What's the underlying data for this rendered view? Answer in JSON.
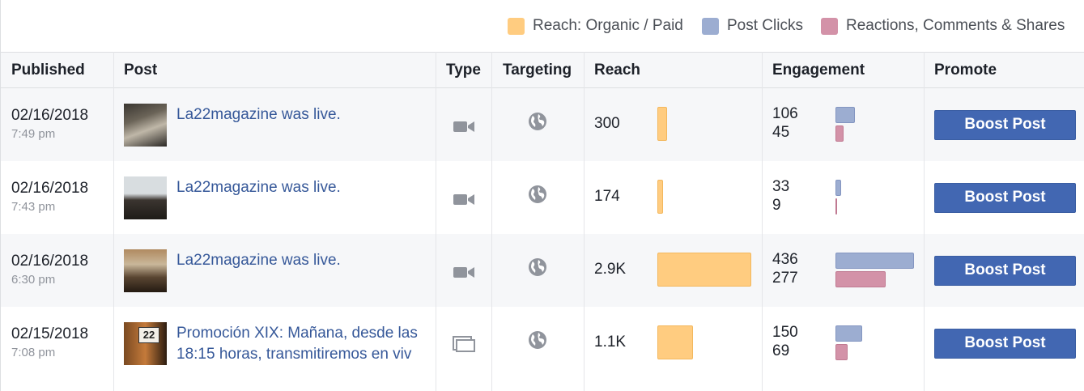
{
  "legend": [
    {
      "label": "Reach: Organic / Paid",
      "color": "#ffcc80"
    },
    {
      "label": "Post Clicks",
      "color": "#9cadd1"
    },
    {
      "label": "Reactions, Comments & Shares",
      "color": "#d392a8"
    }
  ],
  "headers": {
    "published": "Published",
    "post": "Post",
    "type": "Type",
    "targeting": "Targeting",
    "reach": "Reach",
    "engagement": "Engagement",
    "promote": "Promote"
  },
  "rows": [
    {
      "date": "02/16/2018",
      "time": "7:49 pm",
      "post": "La22magazine was live.",
      "type_icon": "video-icon",
      "targeting_icon": "globe-icon",
      "reach": "300",
      "reach_value": 300,
      "clicks": "106",
      "clicks_value": 106,
      "reactions": "45",
      "reactions_value": 45,
      "button": "Boost Post"
    },
    {
      "date": "02/16/2018",
      "time": "7:43 pm",
      "post": "La22magazine was live.",
      "type_icon": "video-icon",
      "targeting_icon": "globe-icon",
      "reach": "174",
      "reach_value": 174,
      "clicks": "33",
      "clicks_value": 33,
      "reactions": "9",
      "reactions_value": 9,
      "button": "Boost Post"
    },
    {
      "date": "02/16/2018",
      "time": "6:30 pm",
      "post": "La22magazine was live.",
      "type_icon": "video-icon",
      "targeting_icon": "globe-icon",
      "reach": "2.9K",
      "reach_value": 2900,
      "clicks": "436",
      "clicks_value": 436,
      "reactions": "277",
      "reactions_value": 277,
      "button": "Boost Post"
    },
    {
      "date": "02/15/2018",
      "time": "7:08 pm",
      "post": "Promoción XIX: Mañana, desde las 18:15 horas, transmitiremos en viv",
      "type_icon": "album-icon",
      "targeting_icon": "globe-icon",
      "reach": "1.1K",
      "reach_value": 1100,
      "clicks": "150",
      "clicks_value": 150,
      "reactions": "69",
      "reactions_value": 69,
      "button": "Boost Post"
    }
  ]
}
